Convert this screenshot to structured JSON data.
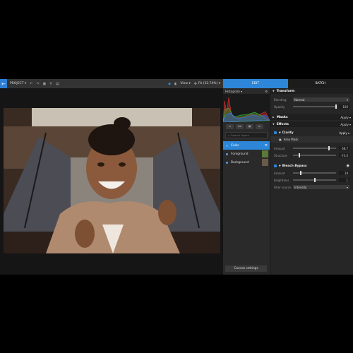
{
  "toolbar": {
    "project_label": "PROJECT ▾",
    "view_label": "View ▾",
    "zoom_label": "Fit (32.74%) ▾"
  },
  "tabs": {
    "edit": "EDIT",
    "batch": "BATCH"
  },
  "layers_panel": {
    "histogram_label": "Histogram ▾",
    "search_placeholder": "Search layers",
    "tool_labels": [
      "",
      "Aa",
      "",
      ""
    ],
    "layers": [
      {
        "name": "Color",
        "selected": true
      },
      {
        "name": "Foreground",
        "selected": false
      },
      {
        "name": "Background",
        "selected": false
      }
    ],
    "canvas_settings": "Canvas settings"
  },
  "properties": {
    "transform": {
      "title": "Transform",
      "blending_label": "Blending",
      "blending_value": "Normal",
      "opacity_label": "Opacity",
      "opacity_value": "100",
      "opacity_fraction": 1.0
    },
    "masks": {
      "title": "Masks",
      "apply": "Apply ▾"
    },
    "effects": {
      "title": "Effects",
      "apply": "Apply ▾"
    },
    "clarity": {
      "title": "Clarity",
      "apply": "Apply ▾",
      "mask_label": "Area Mask",
      "amount_label": "Amount",
      "amount_value": "68.7",
      "amount_fraction": 0.84,
      "structure_label": "Structure",
      "structure_value": "-73.0",
      "structure_fraction": 0.14
    },
    "bleach": {
      "title": "Bleach Bypass",
      "amount_label": "Amount",
      "amount_value": "18",
      "amount_fraction": 0.18,
      "brightness_label": "Brightness",
      "brightness_value": "1",
      "brightness_fraction": 0.5,
      "source_label": "Filter source",
      "source_value": "Intensity"
    }
  },
  "colors": {
    "accent": "#2d86d8",
    "panel": "#262626"
  }
}
